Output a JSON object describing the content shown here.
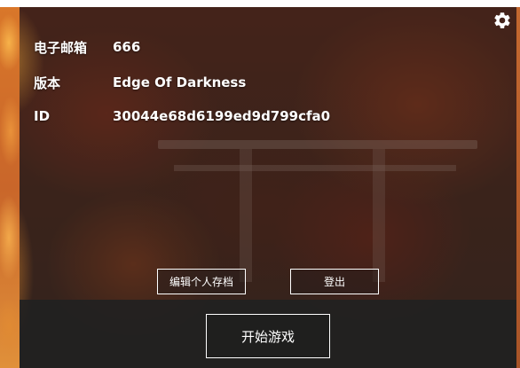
{
  "account": {
    "email_label": "电子邮箱",
    "email_value": "666",
    "version_label": "版本",
    "version_value": "Edge Of Darkness",
    "id_label": "ID",
    "id_value": "30044e68d6199ed9d799cfa0"
  },
  "actions": {
    "edit_profile_label": "编辑个人存档",
    "logout_label": "登出",
    "start_game_label": "开始游戏"
  },
  "icons": {
    "settings": "gear-icon"
  },
  "colors": {
    "text": "#ffffff",
    "bottom_bar": "#202020",
    "button_border": "#ffffff",
    "accent_orange": "#d9772a"
  }
}
